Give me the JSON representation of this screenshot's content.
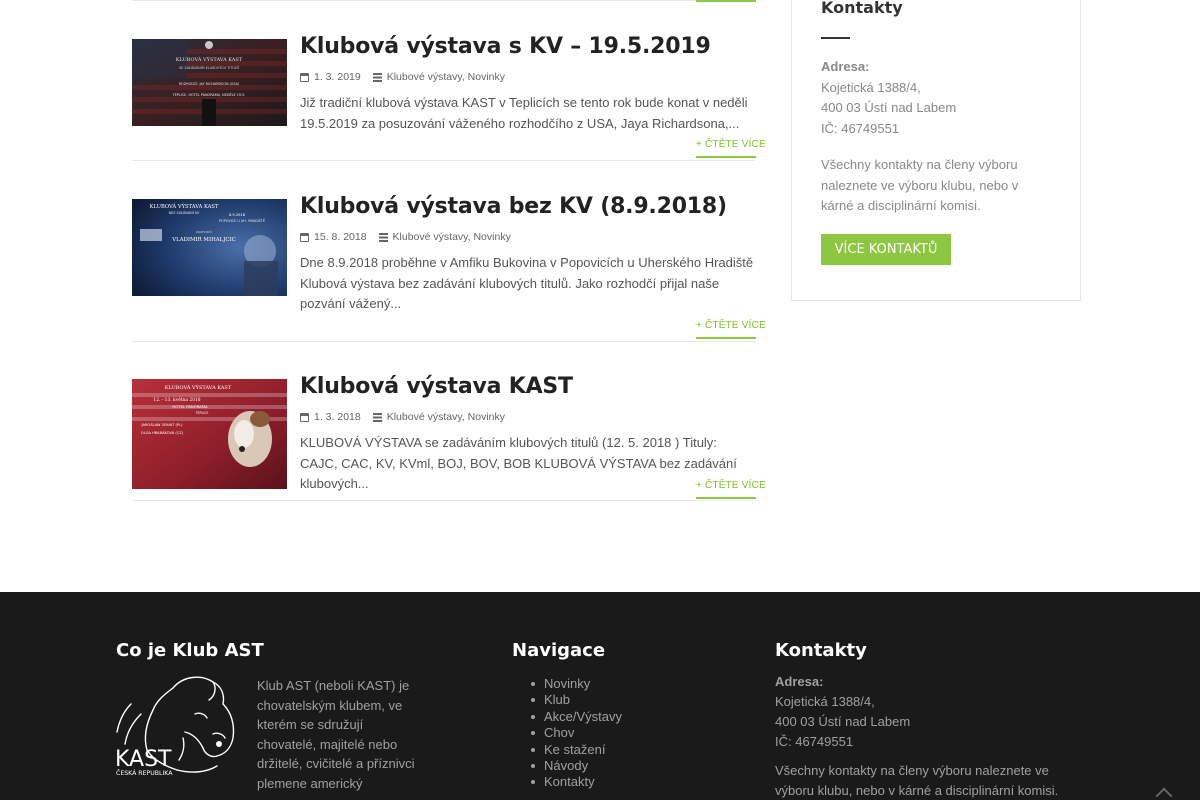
{
  "posts": [
    {
      "title": "Klubová výstava s KV – 19.5.2019",
      "date": "1. 3. 2019",
      "categories": "Klubové výstavy, Novinky",
      "excerpt": "Již tradiční klubová výstava KAST v Teplicích se tento rok bude konat v neděli 19.5.2019 za posuzování váženého rozhodčího z USA, Jaya Richardsona,...",
      "read_more": "+ ČTĚTE VÍCE",
      "thumb": {
        "line1": "KLUBOVÁ VÝSTAVA KAST",
        "line2": "SE ZADÁVÁNÍM KLUBOVÝCH TITULŮ",
        "line3": "ROZHODČÍ: JAY RICHARDSON (USA)",
        "line4": "TEPLICE, HOTEL PANORAMA, NEDĚLE 19.5."
      }
    },
    {
      "title": "Klubová výstava bez KV (8.9.2018)",
      "date": "15. 8. 2018",
      "categories": "Klubové výstavy, Novinky",
      "excerpt": "Dne 8.9.2018 proběhne v Amfiku Bukovina v Popovicích u Uherského Hradiště Klubová výstava bez zadávání klubových titulů. Jako rozhodčí přijal naše pozvání vážený...",
      "read_more": "+ ČTĚTE VÍCE",
      "thumb": {
        "line1": "KLUBOVÁ VÝSTAVA KAST",
        "line2": "BEZ ZADÁVÁNÍ KV",
        "date": "8.9.2018",
        "place": "POPOVICE U UH. HRADIŠTĚ",
        "judge_label": "ROZHODČÍ",
        "judge": "VLADIMIR MIHALJCIC"
      }
    },
    {
      "title": "Klubová výstava KAST",
      "date": "1. 3. 2018",
      "categories": "Klubové výstavy, Novinky",
      "excerpt": "KLUBOVÁ VÝSTAVA se zadáváním klubových titulů (12. 5. 2018 ) Tituly: CAJC, CAC, KV, KVml, BOJ, BOV, BOB KLUBOVÁ VÝSTAVA bez zadávání klubových...",
      "read_more": "+ ČTĚTE VÍCE",
      "thumb": {
        "line1": "KLUBOVÁ VÝSTAVA KAST",
        "date": "12. - 13. května 2018",
        "place": "HOTEL PANORAMA",
        "city": "TEPLICE",
        "judge1": "JAROSLAW GRUNT (PL)",
        "judge2": "OLGA HRABÁKOVÁ (CZ)"
      }
    }
  ],
  "sidebar": {
    "title": "Kontakty",
    "address_label": "Adresa:",
    "address_line1": "Kojetická 1388/4,",
    "address_line2": "400 03 Ústí nad Labem",
    "ico": "IČ: 46749551",
    "note": "Všechny kontakty na členy výboru naleznete ve výboru klubu, nebo v kárné a disciplinární komisi.",
    "button": "VÍCE KONTAKTŮ"
  },
  "footer": {
    "about_title": "Co je Klub AST",
    "about_text": "Klub AST (neboli KAST) je chovatelským klubem, ve kterém se sdružují chovatelé, majitelé nebo držitelé, cvičitelé a příznivci plemene americký",
    "logo_text": "KAST",
    "logo_sub": "ČESKÁ REPUBLIKA",
    "nav_title": "Navigace",
    "nav_items": [
      "Novinky",
      "Klub",
      "Akce/Výstavy",
      "Chov",
      "Ke stažení",
      "Návody",
      "Kontakty"
    ],
    "contact_title": "Kontakty",
    "address_label": "Adresa:",
    "address_line1": "Kojetická 1388/4,",
    "address_line2": "400 03 Ústí nad Labem",
    "ico": "IČ: 46749551",
    "note": "Všechny kontakty na členy výboru naleznete ve výboru klubu, nebo v  kárné a disciplinární komisi."
  }
}
